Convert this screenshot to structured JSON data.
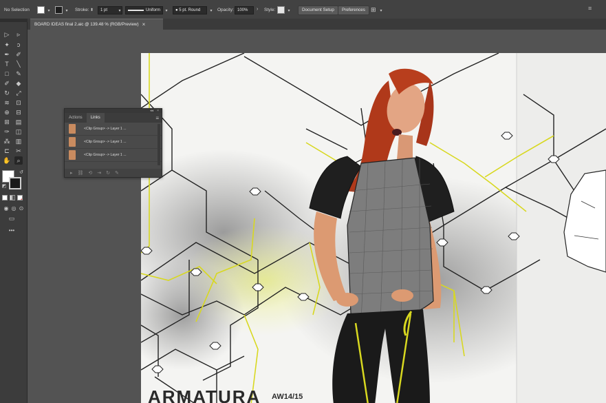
{
  "control_bar": {
    "selection_label": "No Selection",
    "stroke_label": "Stroke:",
    "stroke_value": "1 pt",
    "stroke_profile": "Uniform",
    "brush": "5 pt. Round",
    "opacity_label": "Opacity:",
    "opacity_value": "100%",
    "style_label": "Style:",
    "document_setup_label": "Document Setup",
    "preferences_label": "Preferences"
  },
  "document_tab": {
    "title": "BOARD IDEAS final 2.aic @ 139.48 % (RGB/Preview)",
    "close": "×"
  },
  "links_panel": {
    "tabs": [
      "Actions",
      "Links"
    ],
    "selected_tab": "Links",
    "items": [
      "<Clip Group> -> Layer 1 ...",
      "<Clip Group> -> Layer 1 ...",
      "<Clip Group> -> Layer 1 ..."
    ]
  },
  "artwork": {
    "title_text": "ARMATURA",
    "season_text": "AW14/15"
  },
  "colors": {
    "accent_yellow": "#d8d820",
    "line_black": "#222222",
    "hair": "#b8441f",
    "top_grey": "#7d7d7d"
  }
}
